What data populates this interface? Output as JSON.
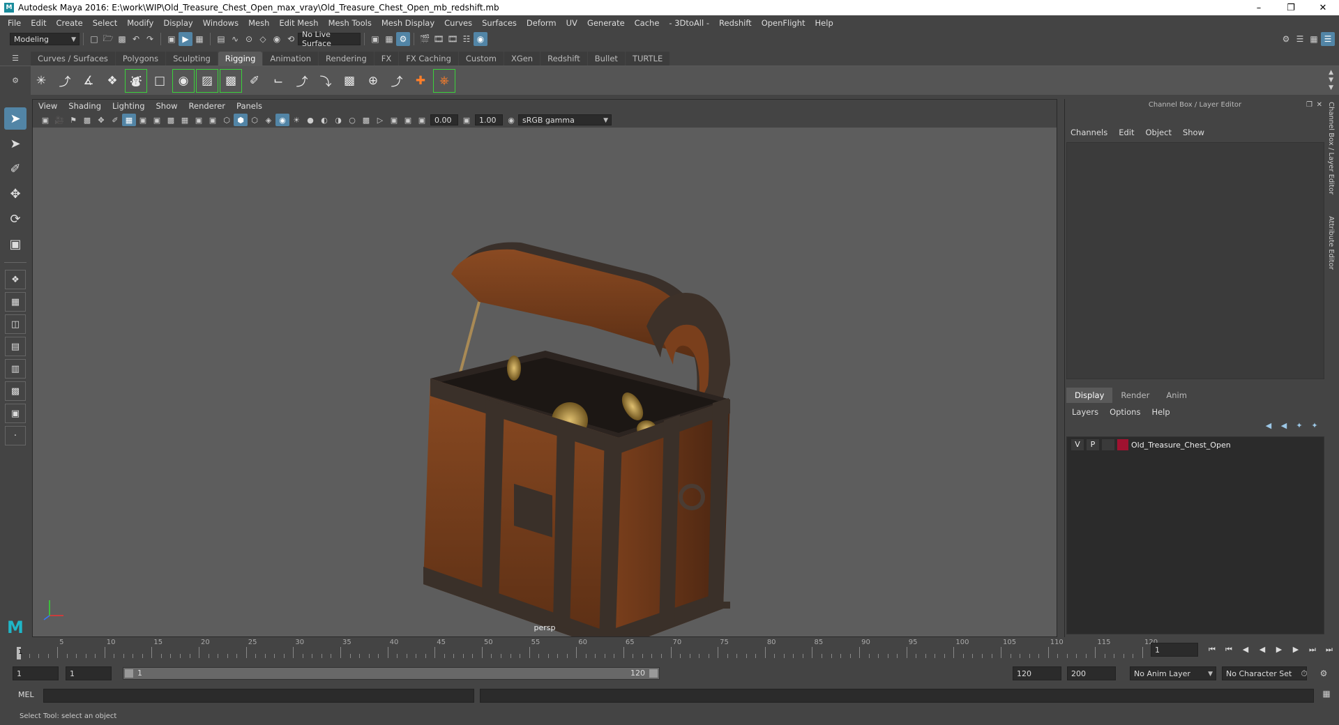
{
  "window": {
    "title": "Autodesk Maya 2016: E:\\work\\WIP\\Old_Treasure_Chest_Open_max_vray\\Old_Treasure_Chest_Open_mb_redshift.mb"
  },
  "menu": [
    "File",
    "Edit",
    "Create",
    "Select",
    "Modify",
    "Display",
    "Windows",
    "Mesh",
    "Edit Mesh",
    "Mesh Tools",
    "Mesh Display",
    "Curves",
    "Surfaces",
    "Deform",
    "UV",
    "Generate",
    "Cache",
    "- 3DtoAll -",
    "Redshift",
    "OpenFlight",
    "Help"
  ],
  "statusline": {
    "mode": "Modeling",
    "live_surface": "No Live Surface"
  },
  "shelf": {
    "tabs": [
      "Curves / Surfaces",
      "Polygons",
      "Sculpting",
      "Rigging",
      "Animation",
      "Rendering",
      "FX",
      "FX Caching",
      "Custom",
      "XGen",
      "Redshift",
      "Bullet",
      "TURTLE"
    ],
    "active_tab": "Rigging"
  },
  "viewport": {
    "menu": [
      "View",
      "Shading",
      "Lighting",
      "Show",
      "Renderer",
      "Panels"
    ],
    "exposure": "0.00",
    "gamma": "1.00",
    "color_space": "sRGB gamma",
    "camera": "persp"
  },
  "channel_box": {
    "title": "Channel Box / Layer Editor",
    "menu": [
      "Channels",
      "Edit",
      "Object",
      "Show"
    ]
  },
  "layer_editor": {
    "tabs": [
      "Display",
      "Render",
      "Anim"
    ],
    "active_tab": "Display",
    "menu": [
      "Layers",
      "Options",
      "Help"
    ],
    "layers": [
      {
        "v": "V",
        "p": "P",
        "name": "Old_Treasure_Chest_Open",
        "color": "#a01230"
      }
    ]
  },
  "side_tabs": [
    "Channel Box / Layer Editor",
    "Attribute Editor"
  ],
  "time_slider": {
    "ticks": [
      "5",
      "10",
      "15",
      "20",
      "25",
      "30",
      "35",
      "40",
      "45",
      "50",
      "55",
      "60",
      "65",
      "70",
      "75",
      "80",
      "85",
      "90",
      "95",
      "100",
      "105",
      "110",
      "115",
      "120"
    ],
    "current_frame": "1",
    "current_time_field": "1"
  },
  "range_slider": {
    "start_time": "1",
    "playback_start": "1",
    "range_start_label": "1",
    "range_end_label": "120",
    "playback_end": "120",
    "end_time": "200",
    "anim_layer": "No Anim Layer",
    "character_set": "No Character Set"
  },
  "command_line": {
    "label": "MEL"
  },
  "help_line": "Select Tool: select an object"
}
